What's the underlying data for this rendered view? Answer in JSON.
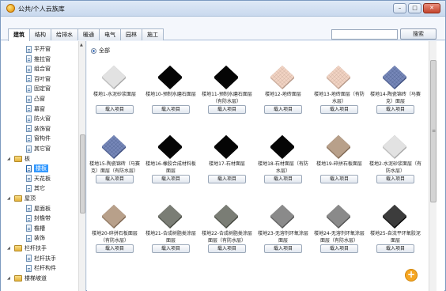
{
  "window": {
    "title": "公共/个人云族库",
    "minimize": "–",
    "maximize": "□",
    "close": "✕"
  },
  "tabs": [
    {
      "label": "建筑",
      "active": true
    },
    {
      "label": "结构"
    },
    {
      "label": "给排水"
    },
    {
      "label": "暖通"
    },
    {
      "label": "电气"
    },
    {
      "label": "园林"
    },
    {
      "label": "施工"
    }
  ],
  "search": {
    "placeholder": "",
    "button": "搜索"
  },
  "tree": [
    {
      "label": "平开窗",
      "type": "doc"
    },
    {
      "label": "推拉窗",
      "type": "doc"
    },
    {
      "label": "组合窗",
      "type": "doc"
    },
    {
      "label": "百叶窗",
      "type": "doc"
    },
    {
      "label": "固定窗",
      "type": "doc"
    },
    {
      "label": "凸窗",
      "type": "doc"
    },
    {
      "label": "幕窗",
      "type": "doc"
    },
    {
      "label": "防火窗",
      "type": "doc"
    },
    {
      "label": "装饰窗",
      "type": "doc"
    },
    {
      "label": "窗构件",
      "type": "doc"
    },
    {
      "label": "其它窗",
      "type": "doc"
    },
    {
      "label": "板",
      "type": "folder",
      "arrow": "◢"
    },
    {
      "label": "楼板",
      "type": "doc",
      "selected": true
    },
    {
      "label": "天花板",
      "type": "doc"
    },
    {
      "label": "其它",
      "type": "doc"
    },
    {
      "label": "屋顶",
      "type": "folder",
      "arrow": "◢"
    },
    {
      "label": "屋面板",
      "type": "doc"
    },
    {
      "label": "封檐带",
      "type": "doc"
    },
    {
      "label": "檐槽",
      "type": "doc"
    },
    {
      "label": "装饰",
      "type": "doc"
    },
    {
      "label": "栏杆扶手",
      "type": "folder",
      "arrow": "◢"
    },
    {
      "label": "栏杆扶手",
      "type": "doc"
    },
    {
      "label": "栏杆构件",
      "type": "doc"
    },
    {
      "label": "楼梯坡道",
      "type": "folder",
      "arrow": "◢"
    }
  ],
  "filter": {
    "label": "全部"
  },
  "import_label": "载入项目",
  "items": [
    {
      "name": "楼地1-水泥砂浆面层",
      "color": "#e2e2e2",
      "pattern": "none"
    },
    {
      "name": "楼地10-预制水磨石面层",
      "color": "#050505",
      "pattern": "none"
    },
    {
      "name": "楼地11-预制水磨石面层（有防水层）",
      "color": "#050505",
      "pattern": "none"
    },
    {
      "name": "楼地12-地砖面层",
      "color": "#f1d3c3",
      "pattern": "grid"
    },
    {
      "name": "楼地13-地砖面层（有防水层）",
      "color": "#f1d3c3",
      "pattern": "grid"
    },
    {
      "name": "楼地14-陶瓷锦砖（马赛克）面层",
      "color": "#7687b8",
      "pattern": "grid"
    },
    {
      "name": "楼地15-陶瓷锦砖（马赛克）面层（有防水层）",
      "color": "#7687b8",
      "pattern": "grid"
    },
    {
      "name": "楼地16-橡胶合成材料板面层",
      "color": "#050505",
      "pattern": "none"
    },
    {
      "name": "楼地17-石材面层",
      "color": "#050505",
      "pattern": "none"
    },
    {
      "name": "楼地18-石材面层（有防水层）",
      "color": "#050505",
      "pattern": "none"
    },
    {
      "name": "楼地19-碎拼石板面层",
      "color": "#b8a08a",
      "pattern": "none"
    },
    {
      "name": "楼地2-水泥砂浆面层（有防水层）",
      "color": "#e2e2e2",
      "pattern": "none"
    },
    {
      "name": "楼地20-碎拼石板面层（有防水层）",
      "color": "#b8a08a",
      "pattern": "none"
    },
    {
      "name": "楼地21-合成树脂类涂层面层",
      "color": "#7a7d75",
      "pattern": "none"
    },
    {
      "name": "楼地22-合成树脂类涂层面层（有防水层）",
      "color": "#7a7d75",
      "pattern": "none"
    },
    {
      "name": "楼地23-无溶剂环氧涂层面层",
      "color": "#8a8a8a",
      "pattern": "none"
    },
    {
      "name": "楼地24-无溶剂环氧涂层面层（有防水层）",
      "color": "#8a8a8a",
      "pattern": "none"
    },
    {
      "name": "楼地25-自流平环氧胶泥面层",
      "color": "#3c3c3c",
      "pattern": "none"
    }
  ],
  "colors": {
    "accent": "#3399ff",
    "fab": "#f5a623"
  },
  "fab": "+"
}
